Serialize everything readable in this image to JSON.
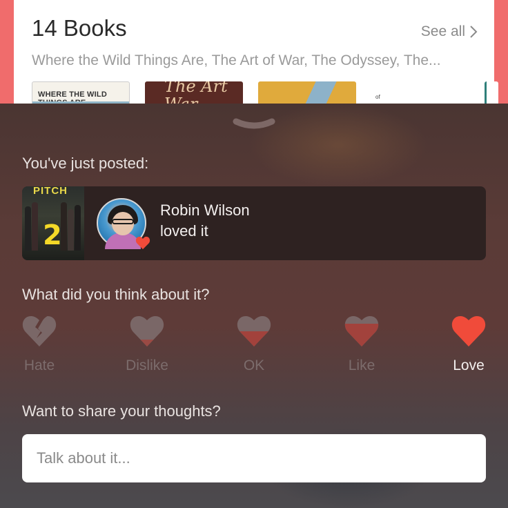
{
  "background": {
    "title": "14 Books",
    "see_all": "See all",
    "subtitle": "Where the Wild Things Are, The Art of War, The Odyssey, The...",
    "covers": [
      {
        "text": "WHERE THE WILD THINGS ARE"
      },
      {
        "text": "The Art War"
      },
      {
        "text": ""
      },
      {
        "text": "of"
      },
      {
        "text": ""
      }
    ]
  },
  "sheet": {
    "posted_label": "You've just posted:",
    "post": {
      "poster_title": "PITCH",
      "poster_number": "2",
      "user_name": "Robin Wilson",
      "action": "loved it"
    },
    "question": "What did you think about it?",
    "ratings": [
      {
        "label": "Hate",
        "selected": false
      },
      {
        "label": "Dislike",
        "selected": false
      },
      {
        "label": "OK",
        "selected": false
      },
      {
        "label": "Like",
        "selected": false
      },
      {
        "label": "Love",
        "selected": true
      }
    ],
    "share_label": "Want to share your thoughts?",
    "share_placeholder": "Talk about it..."
  },
  "colors": {
    "accent": "#f04b3a",
    "background_red": "#f06c6c",
    "inactive_icon": "#7a6767"
  },
  "icons": [
    "chevron-right-icon",
    "chevron-down-icon",
    "heart-icon",
    "broken-heart-icon"
  ]
}
